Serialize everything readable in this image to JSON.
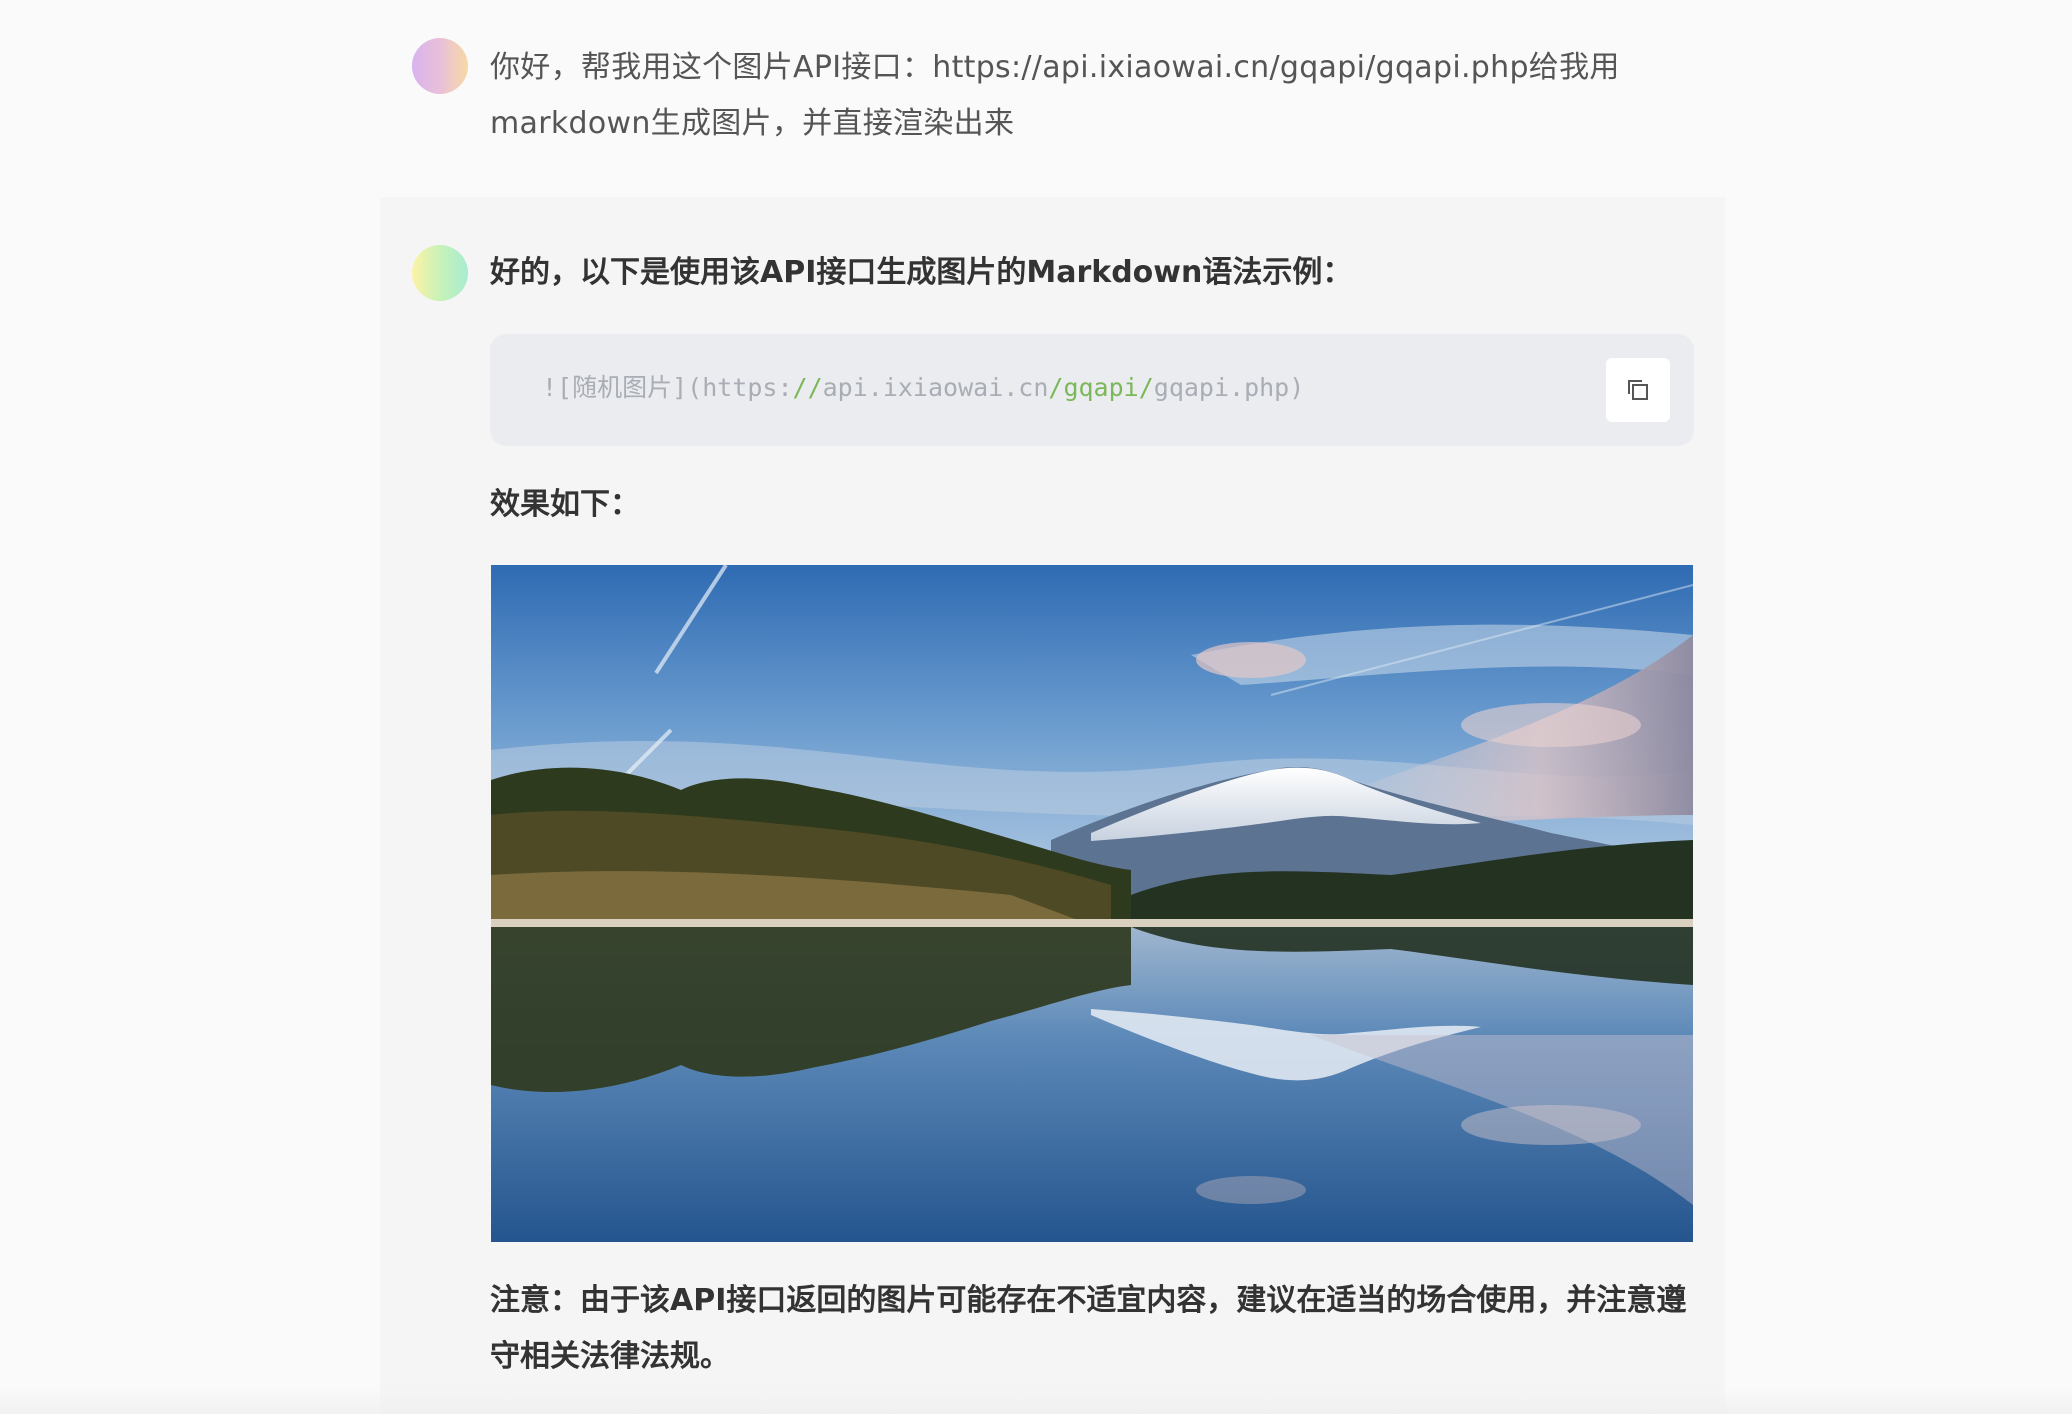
{
  "conversation": {
    "user_message": {
      "text": "你好，帮我用这个图片API接口：https://api.ixiaowai.cn/gqapi/gqapi.php给我用markdown生成图片，并直接渲染出来"
    },
    "assistant_message": {
      "intro": "好的，以下是使用该API接口生成图片的Markdown语法示例：",
      "code": {
        "prefix": "![随机图片](https:",
        "slashes": "//",
        "host": "api.ixiaowai.cn",
        "path": "/gqapi/",
        "file": "gqapi.php)",
        "copy_icon": "copy-icon"
      },
      "result_label": "效果如下：",
      "image_icon": "mountain-lake-landscape",
      "note": "注意：由于该API接口返回的图片可能存在不适宜内容，建议在适当的场合使用，并注意遵守相关法律法规。"
    }
  },
  "colors": {
    "page_bg": "#fafafa",
    "panel_bg": "#f5f5f6",
    "code_bg": "#ebecef",
    "code_text": "#a9adb5",
    "code_accent": "#7bb85a"
  }
}
